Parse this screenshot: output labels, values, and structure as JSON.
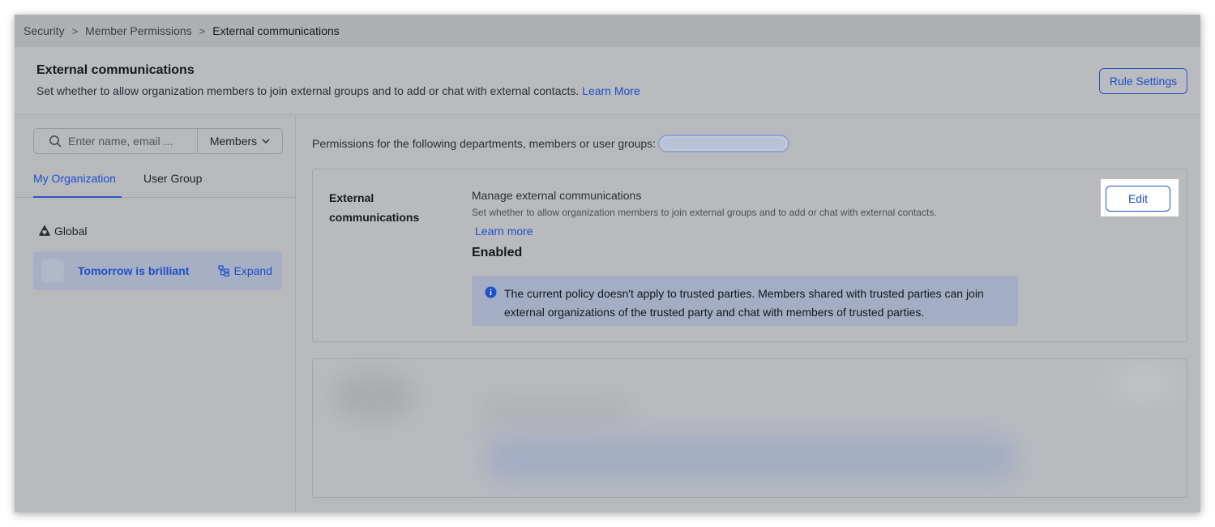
{
  "breadcrumb": {
    "items": [
      "Security",
      "Member Permissions",
      "External communications"
    ],
    "separator": ">"
  },
  "header": {
    "title": "External communications",
    "description": "Set whether to allow organization members to join external groups and to add or chat with external contacts.",
    "learn_more": "Learn More",
    "rule_settings_label": "Rule Settings"
  },
  "left": {
    "search_placeholder": "Enter name, email ...",
    "filter_value": "Members",
    "tabs": [
      {
        "label": "My Organization",
        "active": true
      },
      {
        "label": "User Group",
        "active": false
      }
    ],
    "global_label": "Global",
    "org_item": {
      "name": "Tomorrow is brilliant",
      "expand_label": "Expand"
    }
  },
  "right": {
    "permissions_label": "Permissions for the following departments, members or user groups:",
    "card": {
      "label": "External communications",
      "title": "Manage external communications",
      "subtitle": "Set whether to allow organization members to join external groups and to add or chat with external contacts.",
      "learn_more": "Learn more",
      "status": "Enabled",
      "info": "The current policy doesn't apply to trusted parties. Members shared with trusted parties can join external organizations of the trusted party and chat with members of trusted parties.",
      "edit_label": "Edit"
    }
  },
  "colors": {
    "accent": "#1f4fc9",
    "overlay": "#b7b9bd",
    "info_bg": "#a3adc3"
  }
}
